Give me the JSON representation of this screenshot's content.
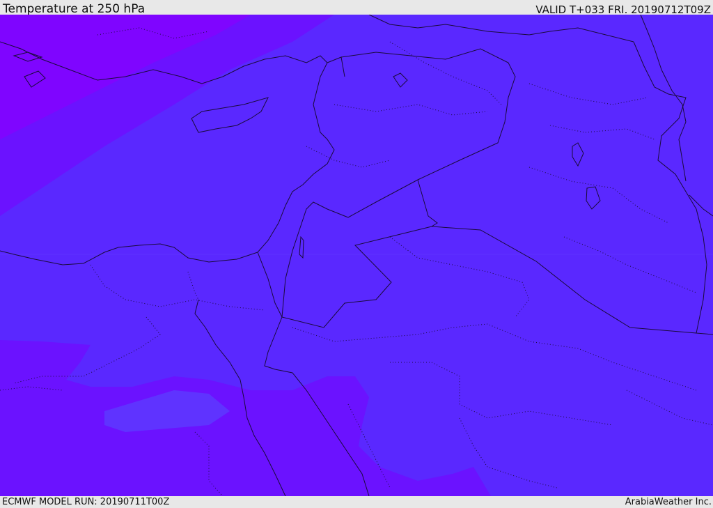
{
  "header": {
    "title": "Temperature at 250 hPa",
    "valid": "VALID T+033 FRI. 20190712T09Z"
  },
  "footer": {
    "model_run": "ECMWF MODEL RUN: 20190711T00Z",
    "credit": "ArabiaWeather Inc."
  },
  "map": {
    "field": "temperature",
    "level": "250 hPa",
    "colors": {
      "main": "#5a28ff",
      "colder": "#6b12ff",
      "coldest": "#7f05ff",
      "warm_patch": "#5c3cff",
      "coastline": "#1a0a3a",
      "border": "#1a0a3a"
    }
  }
}
